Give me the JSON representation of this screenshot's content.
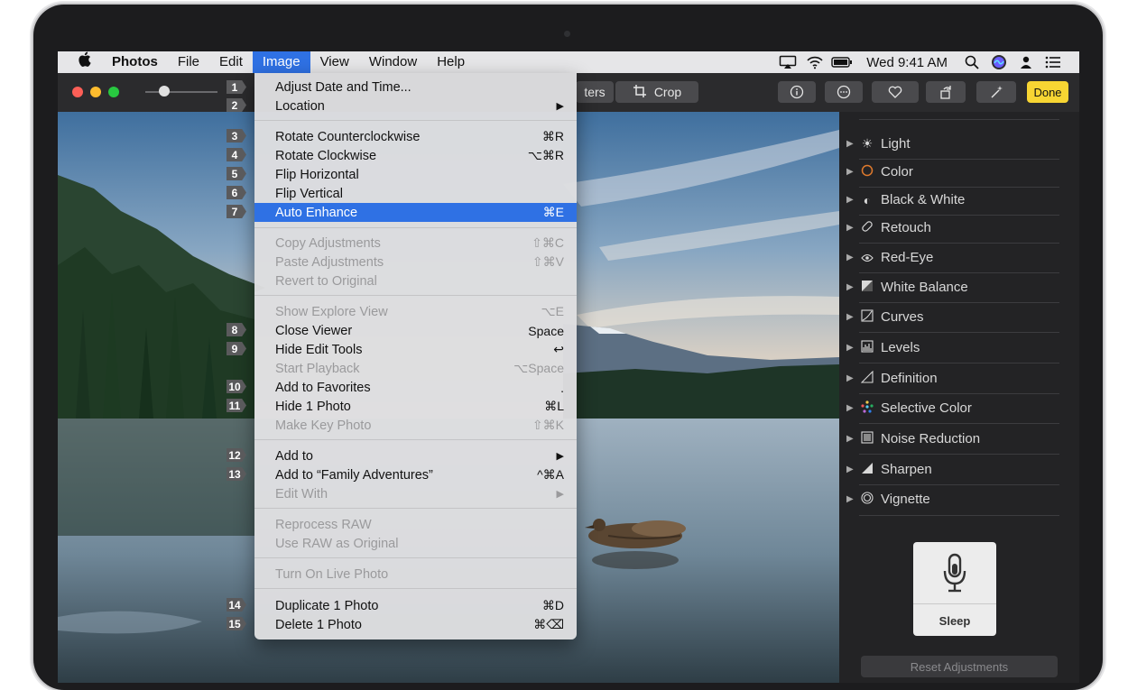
{
  "menubar": {
    "apple": "",
    "app_name": "Photos",
    "items": [
      "File",
      "Edit",
      "Image",
      "View",
      "Window",
      "Help"
    ],
    "active_item": "Image",
    "clock": "Wed 9:41 AM"
  },
  "toolbar": {
    "filters_label": "ters",
    "crop_label": "Crop",
    "done_label": "Done"
  },
  "image_menu": {
    "items": [
      {
        "label": "Adjust Date and Time...",
        "shortcut": "",
        "disabled": false
      },
      {
        "label": "Location",
        "shortcut": "▶",
        "disabled": false
      },
      {
        "label": "Rotate Counterclockwise",
        "shortcut": "⌘R",
        "disabled": false
      },
      {
        "label": "Rotate Clockwise",
        "shortcut": "⌥⌘R",
        "disabled": false
      },
      {
        "label": "Flip Horizontal",
        "shortcut": "",
        "disabled": false
      },
      {
        "label": "Flip Vertical",
        "shortcut": "",
        "disabled": false
      },
      {
        "label": "Auto Enhance",
        "shortcut": "⌘E",
        "disabled": false,
        "highlighted": true
      },
      {
        "label": "Copy Adjustments",
        "shortcut": "⇧⌘C",
        "disabled": true
      },
      {
        "label": "Paste Adjustments",
        "shortcut": "⇧⌘V",
        "disabled": true
      },
      {
        "label": "Revert to Original",
        "shortcut": "",
        "disabled": true
      },
      {
        "label": "Show Explore View",
        "shortcut": "⌥E",
        "disabled": true
      },
      {
        "label": "Close Viewer",
        "shortcut": "Space",
        "disabled": false
      },
      {
        "label": "Hide Edit Tools",
        "shortcut": "↩",
        "disabled": false
      },
      {
        "label": "Start Playback",
        "shortcut": "⌥Space",
        "disabled": true
      },
      {
        "label": "Add to Favorites",
        "shortcut": ".",
        "disabled": false
      },
      {
        "label": "Hide 1 Photo",
        "shortcut": "⌘L",
        "disabled": false
      },
      {
        "label": "Make Key Photo",
        "shortcut": "⇧⌘K",
        "disabled": true
      },
      {
        "label": "Add to",
        "shortcut": "▶",
        "disabled": false
      },
      {
        "label": "Add to “Family Adventures”",
        "shortcut": "^⌘A",
        "disabled": false
      },
      {
        "label": "Edit With",
        "shortcut": "▶",
        "disabled": true
      },
      {
        "label": "Reprocess RAW",
        "shortcut": "",
        "disabled": true
      },
      {
        "label": "Use RAW as Original",
        "shortcut": "",
        "disabled": true
      },
      {
        "label": "Turn On Live Photo",
        "shortcut": "",
        "disabled": true
      },
      {
        "label": "Duplicate 1 Photo",
        "shortcut": "⌘D",
        "disabled": false
      },
      {
        "label": "Delete 1 Photo",
        "shortcut": "⌘⌫",
        "disabled": false
      }
    ]
  },
  "tags": [
    "1",
    "2",
    "3",
    "4",
    "5",
    "6",
    "7",
    "8",
    "9",
    "10",
    "11",
    "12",
    "13",
    "14",
    "15"
  ],
  "adjustments": {
    "items": [
      {
        "label": "Light",
        "icon": "sun-icon"
      },
      {
        "label": "Color",
        "icon": "color-circle-icon"
      },
      {
        "label": "Black & White",
        "icon": "half-circle-icon"
      },
      {
        "label": "Retouch",
        "icon": "bandage-icon"
      },
      {
        "label": "Red-Eye",
        "icon": "eye-icon"
      },
      {
        "label": "White Balance",
        "icon": "white-balance-icon"
      },
      {
        "label": "Curves",
        "icon": "curves-icon"
      },
      {
        "label": "Levels",
        "icon": "levels-icon"
      },
      {
        "label": "Definition",
        "icon": "triangle-icon"
      },
      {
        "label": "Selective Color",
        "icon": "dots-icon"
      },
      {
        "label": "Noise Reduction",
        "icon": "square-icon"
      },
      {
        "label": "Sharpen",
        "icon": "wedge-icon"
      },
      {
        "label": "Vignette",
        "icon": "ring-icon"
      }
    ],
    "sleep_label": "Sleep",
    "reset_label": "Reset Adjustments"
  }
}
